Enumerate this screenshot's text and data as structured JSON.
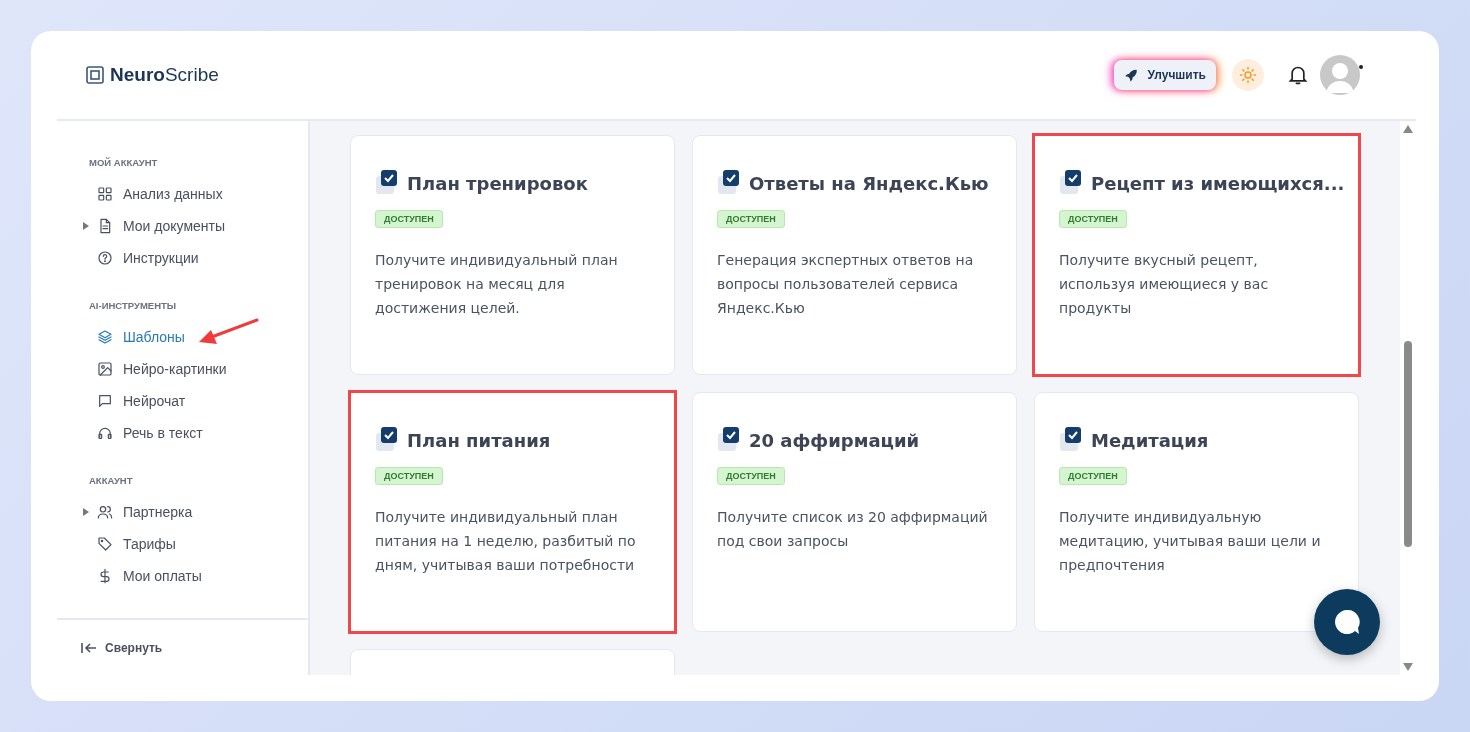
{
  "header": {
    "logo_bold": "Neuro",
    "logo_light": "Scribe",
    "upgrade_button": "Улучшить"
  },
  "sidebar": {
    "sections": [
      {
        "title": "МОЙ АККАУНТ",
        "items": [
          {
            "label": "Анализ данных",
            "expandable": false,
            "selected": false,
            "annotated": false
          },
          {
            "label": "Мои документы",
            "expandable": true,
            "selected": false,
            "annotated": false
          },
          {
            "label": "Инструкции",
            "expandable": false,
            "selected": false,
            "annotated": false
          }
        ]
      },
      {
        "title": "AI-ИНСТРУМЕНТЫ",
        "items": [
          {
            "label": "Шаблоны",
            "expandable": false,
            "selected": true,
            "annotated": true
          },
          {
            "label": "Нейро-картинки",
            "expandable": false,
            "selected": false,
            "annotated": false
          },
          {
            "label": "Нейрочат",
            "expandable": false,
            "selected": false,
            "annotated": false
          },
          {
            "label": "Речь в текст",
            "expandable": false,
            "selected": false,
            "annotated": false
          }
        ]
      },
      {
        "title": "АККАУНТ",
        "items": [
          {
            "label": "Партнерка",
            "expandable": true,
            "selected": false,
            "annotated": false
          },
          {
            "label": "Тарифы",
            "expandable": false,
            "selected": false,
            "annotated": false
          },
          {
            "label": "Мои оплаты",
            "expandable": false,
            "selected": false,
            "annotated": false
          }
        ]
      }
    ],
    "collapse": "Свернуть"
  },
  "cards": [
    {
      "title": "План тренировок",
      "badge": "ДОСТУПЕН",
      "description": "Получите индивидуальный план тренировок на месяц для достижения целей.",
      "highlighted": false
    },
    {
      "title": "Ответы на Яндекс.Кью",
      "badge": "ДОСТУПЕН",
      "description": "Генерация экспертных ответов на вопросы пользователей сервиса Яндекс.Кью",
      "highlighted": false
    },
    {
      "title": "Рецепт из имеющихся...",
      "badge": "ДОСТУПЕН",
      "description": "Получите вкусный рецепт, используя имеющиеся у вас продукты",
      "highlighted": true
    },
    {
      "title": "План питания",
      "badge": "ДОСТУПЕН",
      "description": "Получите индивидуальный план питания на 1 неделю, разбитый по дням, учитывая ваши потребности",
      "highlighted": true
    },
    {
      "title": "20 аффирмаций",
      "badge": "ДОСТУПЕН",
      "description": "Получите список из 20 аффирмаций под свои запросы",
      "highlighted": false
    },
    {
      "title": "Медитация",
      "badge": "ДОСТУПЕН",
      "description": "Получите индивидуальную медитацию, учитывая ваши цели и предпочтения",
      "highlighted": false
    }
  ]
}
